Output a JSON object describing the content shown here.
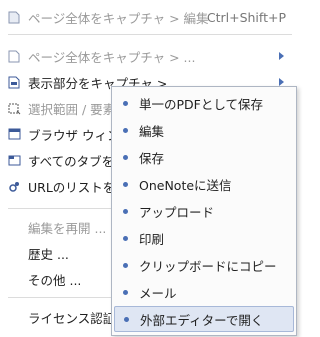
{
  "menu": {
    "items": [
      {
        "label": "ページ全体をキャプチャ > 編集",
        "shortcut": "Ctrl+Shift+P",
        "icon": "page-capture-icon"
      },
      {
        "label": "ページ全体をキャプチャ > ...",
        "icon": "page-icon"
      },
      {
        "label": "表示部分をキャプチャ >",
        "icon": "visible-area-icon"
      },
      {
        "label": "選択範囲 / 要素",
        "icon": "selection-icon"
      },
      {
        "label": "ブラウザ ウィン",
        "icon": "window-icon"
      },
      {
        "label": "すべてのタブを",
        "icon": "tabs-icon"
      },
      {
        "label": "URLのリストを",
        "icon": "url-list-icon"
      },
      {
        "label": "編集を再開 ..."
      },
      {
        "label": "歴史 ..."
      },
      {
        "label": "その他 ..."
      },
      {
        "label": "ライセンス認証"
      }
    ]
  },
  "submenu": {
    "items": [
      {
        "label": "単一のPDFとして保存"
      },
      {
        "label": "編集"
      },
      {
        "label": "保存"
      },
      {
        "label": "OneNoteに送信"
      },
      {
        "label": "アップロード"
      },
      {
        "label": "印刷"
      },
      {
        "label": "クリップボードにコピー"
      },
      {
        "label": "メール"
      },
      {
        "label": "外部エディターで開く"
      }
    ]
  },
  "colors": {
    "accent": "#4a6fb5",
    "disabled_text": "#9a9a9a",
    "highlight": "#dfe6f3"
  }
}
